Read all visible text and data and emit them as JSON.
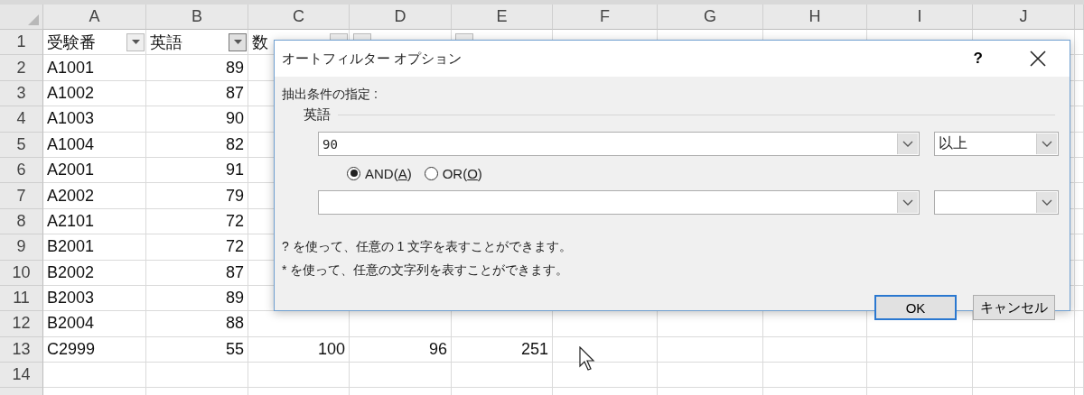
{
  "columns": [
    "A",
    "B",
    "C",
    "D",
    "E",
    "F",
    "G",
    "H",
    "I",
    "J"
  ],
  "rows": [
    {
      "number": "1",
      "cells": [
        {
          "text": "受験番",
          "kind": "header",
          "pressed": false
        },
        {
          "text": "英語",
          "kind": "header",
          "pressed": true
        },
        {
          "text": "数",
          "kind": "header",
          "pressed": false
        },
        {
          "kind": "header",
          "pressed": false
        },
        {
          "kind": "header",
          "pressed": false
        }
      ]
    },
    {
      "number": "2",
      "cells": [
        {
          "text": "A1001",
          "kind": "text"
        },
        {
          "text": "89",
          "kind": "number"
        }
      ]
    },
    {
      "number": "3",
      "cells": [
        {
          "text": "A1002",
          "kind": "text"
        },
        {
          "text": "87",
          "kind": "number"
        }
      ]
    },
    {
      "number": "4",
      "cells": [
        {
          "text": "A1003",
          "kind": "text"
        },
        {
          "text": "90",
          "kind": "number"
        }
      ]
    },
    {
      "number": "5",
      "cells": [
        {
          "text": "A1004",
          "kind": "text"
        },
        {
          "text": "82",
          "kind": "number"
        }
      ]
    },
    {
      "number": "6",
      "cells": [
        {
          "text": "A2001",
          "kind": "text"
        },
        {
          "text": "91",
          "kind": "number"
        }
      ]
    },
    {
      "number": "7",
      "cells": [
        {
          "text": "A2002",
          "kind": "text"
        },
        {
          "text": "79",
          "kind": "number"
        }
      ]
    },
    {
      "number": "8",
      "cells": [
        {
          "text": "A2101",
          "kind": "text"
        },
        {
          "text": "72",
          "kind": "number"
        }
      ]
    },
    {
      "number": "9",
      "cells": [
        {
          "text": "B2001",
          "kind": "text"
        },
        {
          "text": "72",
          "kind": "number"
        }
      ]
    },
    {
      "number": "10",
      "cells": [
        {
          "text": "B2002",
          "kind": "text"
        },
        {
          "text": "87",
          "kind": "number"
        }
      ]
    },
    {
      "number": "11",
      "cells": [
        {
          "text": "B2003",
          "kind": "text"
        },
        {
          "text": "89",
          "kind": "number"
        }
      ]
    },
    {
      "number": "12",
      "cells": [
        {
          "text": "B2004",
          "kind": "text"
        },
        {
          "text": "88",
          "kind": "number"
        }
      ]
    },
    {
      "number": "13",
      "cells": [
        {
          "text": "C2999",
          "kind": "text"
        },
        {
          "text": "55",
          "kind": "number"
        },
        {
          "text": "100",
          "kind": "number"
        },
        {
          "text": "96",
          "kind": "number"
        },
        {
          "text": "251",
          "kind": "number"
        }
      ]
    },
    {
      "number": "14",
      "cells": []
    }
  ],
  "dialog": {
    "title": "オートフィルター オプション",
    "help": "?",
    "criteria_label": "抽出条件の指定 :",
    "field_label": "英語",
    "condition_1": {
      "value": "90",
      "operator": "以上"
    },
    "logic": [
      {
        "prefix": "AND(",
        "mnemonic": "A",
        "suffix": ")",
        "selected": true
      },
      {
        "prefix": "OR(",
        "mnemonic": "O",
        "suffix": ")",
        "selected": false
      }
    ],
    "hints": [
      "? を使って、任意の 1 文字を表すことができます。",
      "* を使って、任意の文字列を表すことができます。"
    ],
    "buttons": [
      {
        "label": "OK",
        "default": true
      },
      {
        "label": "キャンセル",
        "default": false
      }
    ]
  }
}
